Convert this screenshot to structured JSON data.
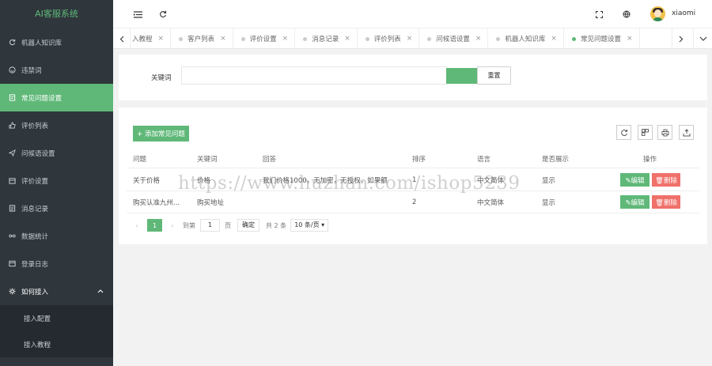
{
  "app_title": "AI客服系统",
  "sidebar": {
    "items": [
      {
        "label": "机器人知识库",
        "icon": "refresh-icon"
      },
      {
        "label": "违禁词",
        "icon": "smile-icon"
      },
      {
        "label": "常见问题设置",
        "icon": "doc-icon",
        "active": true
      },
      {
        "label": "评价列表",
        "icon": "thumb-icon"
      },
      {
        "label": "问候语设置",
        "icon": "send-icon"
      },
      {
        "label": "评价设置",
        "icon": "calendar-icon"
      },
      {
        "label": "消息记录",
        "icon": "list-icon"
      },
      {
        "label": "数据统计",
        "icon": "chart-icon"
      },
      {
        "label": "登录日志",
        "icon": "log-icon"
      },
      {
        "label": "如何接入",
        "icon": "gear-icon",
        "expanded": true
      }
    ],
    "subitems": [
      {
        "label": "接入配置"
      },
      {
        "label": "接入教程"
      }
    ]
  },
  "header": {
    "username": "xiaomi"
  },
  "tabs": [
    {
      "label": "入教程"
    },
    {
      "label": "客户列表"
    },
    {
      "label": "评价设置"
    },
    {
      "label": "消息记录"
    },
    {
      "label": "评价列表"
    },
    {
      "label": "问候语设置"
    },
    {
      "label": "机器人知识库"
    },
    {
      "label": "常见问题设置",
      "active": true
    }
  ],
  "search": {
    "label": "关键词",
    "value": "",
    "reset_label": "重置"
  },
  "table": {
    "add_label": "+ 添加常见问题",
    "columns": [
      "问题",
      "关键词",
      "回答",
      "排序",
      "语言",
      "是否展示",
      "操作"
    ],
    "rows": [
      {
        "question": "关于价格",
        "keyword": "价格",
        "answer": "我们价格1000，无加密，无授权，如果额",
        "sort": "1",
        "lang": "中文简体",
        "show": "显示"
      },
      {
        "question": "购买认准九州...",
        "keyword": "购买地址",
        "answer": "",
        "sort": "2",
        "lang": "中文简体",
        "show": "显示"
      }
    ],
    "edit_label": "✎编辑",
    "delete_label": "🗑删除"
  },
  "pager": {
    "current": "1",
    "goto_prefix": "到第",
    "goto_value": "1",
    "goto_suffix": "页",
    "confirm_label": "确定",
    "total": "共 2 条",
    "page_size": "10 条/页 ▾"
  },
  "watermark": "https://www.huzhan.com/ishop5239"
}
